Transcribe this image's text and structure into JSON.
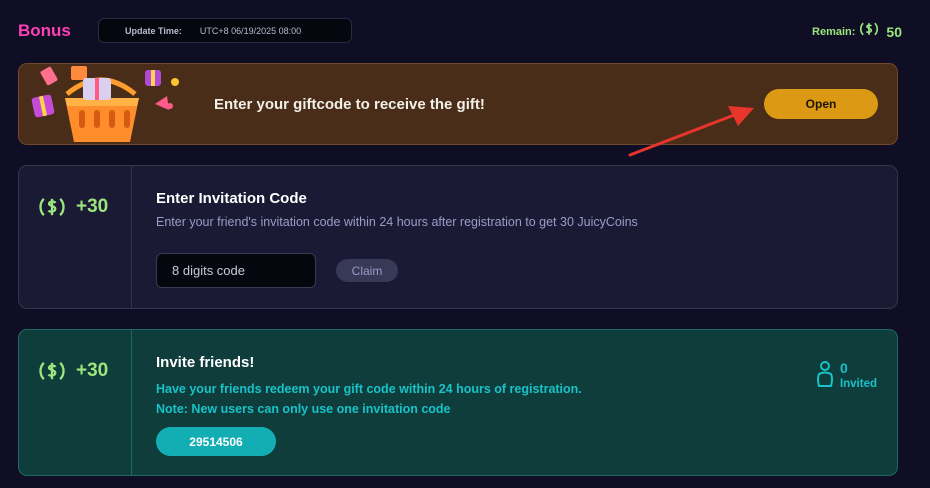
{
  "header": {
    "title": "Bonus",
    "update_label": "Update Time:",
    "update_value": "UTC+8 06/19/2025 08:00",
    "remain_label": "Remain:",
    "remain_value": "50"
  },
  "gift_banner": {
    "text": "Enter your giftcode to receive the gift!",
    "button_label": "Open"
  },
  "invitation_code": {
    "reward": "+30",
    "title": "Enter Invitation Code",
    "description": "Enter your friend's invitation code within 24 hours after registration to get 30 JuicyCoins",
    "input_placeholder": "8 digits code",
    "claim_label": "Claim"
  },
  "invite_friends": {
    "reward": "+30",
    "title": "Invite friends!",
    "description_line1": "Have your friends redeem your gift code within 24 hours of registration.",
    "description_line2": "Note: New users can only use one invitation code",
    "code": "29514506",
    "invited_count": "0",
    "invited_label": "Invited"
  },
  "colors": {
    "accent_pink": "#ff3fb4",
    "coin_green": "#9be67c",
    "open_button": "#dc9a14",
    "teal": "#18c2c9"
  },
  "icons": [
    "coin-icon",
    "gift-basket-icon",
    "annotation-arrow",
    "user-icon"
  ]
}
